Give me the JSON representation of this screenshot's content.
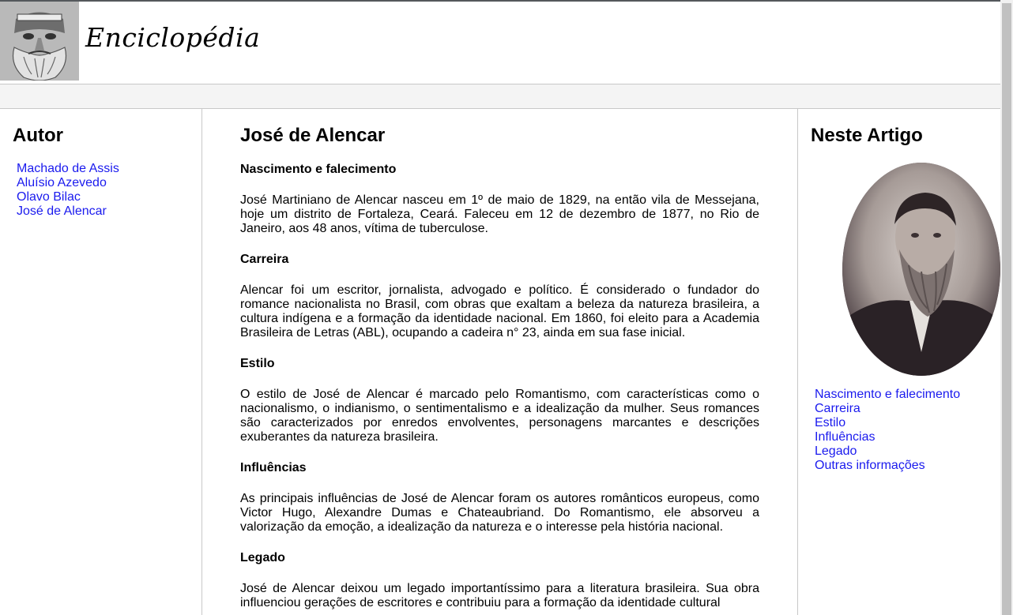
{
  "header": {
    "site_title": "Enciclopédia"
  },
  "left_sidebar": {
    "title": "Autor",
    "items": [
      {
        "label": "Machado de Assis"
      },
      {
        "label": "Aluísio Azevedo"
      },
      {
        "label": "Olavo Bilac"
      },
      {
        "label": "José de Alencar"
      }
    ]
  },
  "article": {
    "title": "José de Alencar",
    "sections": [
      {
        "heading": "Nascimento e falecimento",
        "text": "José Martiniano de Alencar nasceu em 1º de maio de 1829, na então vila de Messejana, hoje um distrito de Fortaleza, Ceará. Faleceu em 12 de dezembro de 1877, no Rio de Janeiro, aos 48 anos, vítima de tuberculose."
      },
      {
        "heading": "Carreira",
        "text": "Alencar foi um escritor, jornalista, advogado e político. É considerado o fundador do romance nacionalista no Brasil, com obras que exaltam a beleza da natureza brasileira, a cultura indígena e a formação da identidade nacional. Em 1860, foi eleito para a Academia Brasileira de Letras (ABL), ocupando a cadeira n° 23, ainda em sua fase inicial."
      },
      {
        "heading": "Estilo",
        "text": "O estilo de José de Alencar é marcado pelo Romantismo, com características como o nacionalismo, o indianismo, o sentimentalismo e a idealização da mulher. Seus romances são caracterizados por enredos envolventes, personagens marcantes e descrições exuberantes da natureza brasileira."
      },
      {
        "heading": "Influências",
        "text": "As principais influências de José de Alencar foram os autores românticos europeus, como Victor Hugo, Alexandre Dumas e Chateaubriand. Do Romantismo, ele absorveu a valorização da emoção, a idealização da natureza e o interesse pela história nacional."
      },
      {
        "heading": "Legado",
        "text": "José de Alencar deixou um legado importantíssimo para a literatura brasileira. Sua obra influenciou gerações de escritores e contribuiu para a formação da identidade cultural"
      }
    ]
  },
  "right_sidebar": {
    "title": "Neste Artigo",
    "items": [
      {
        "label": "Nascimento e falecimento"
      },
      {
        "label": "Carreira"
      },
      {
        "label": "Estilo"
      },
      {
        "label": "Influências"
      },
      {
        "label": "Legado"
      },
      {
        "label": "Outras informações"
      }
    ]
  },
  "colors": {
    "link": "#1a1aee",
    "border": "#c8c8c8",
    "navbar_bg": "#f4f4f4"
  }
}
